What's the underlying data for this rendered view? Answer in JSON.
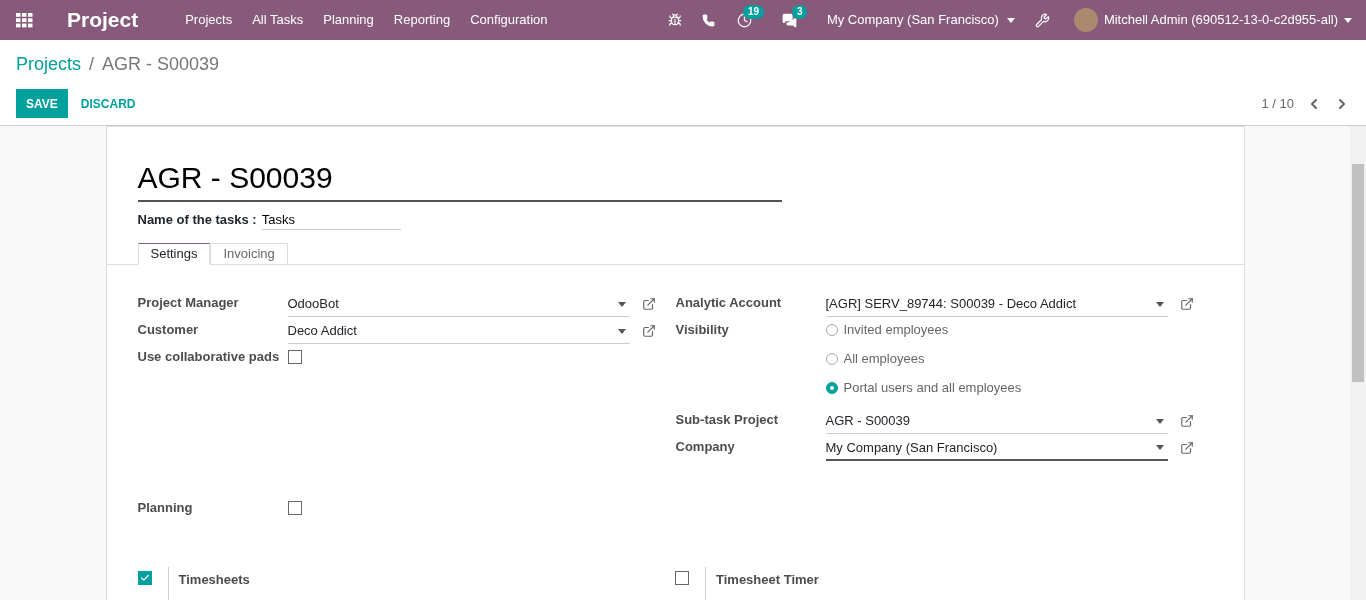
{
  "navbar": {
    "app_title": "Project",
    "menu": [
      "Projects",
      "All Tasks",
      "Planning",
      "Reporting",
      "Configuration"
    ],
    "activity_count": "19",
    "message_count": "3",
    "company": "My Company (San Francisco)",
    "user": "Mitchell Admin (690512-13-0-c2d955-all)"
  },
  "breadcrumb": {
    "items": [
      "Projects",
      "AGR - S00039"
    ],
    "separator": "/"
  },
  "buttons": {
    "save": "SAVE",
    "discard": "DISCARD"
  },
  "pager": "1 / 10",
  "form": {
    "title": "AGR - S00039",
    "tasks_label": "Name of the tasks :",
    "tasks_value": "Tasks",
    "tabs": [
      {
        "label": "Settings",
        "selected": true
      },
      {
        "label": "Invoicing",
        "selected": false
      }
    ],
    "left_fields": [
      {
        "kind": "many2one",
        "label": "Project Manager",
        "value": "OdooBot",
        "focused": false
      },
      {
        "kind": "many2one",
        "label": "Customer",
        "value": "Deco Addict",
        "focused": false
      },
      {
        "kind": "checkbox",
        "label": "Use collaborative pads",
        "checked": false
      }
    ],
    "right_fields": [
      {
        "kind": "many2one",
        "label": "Analytic Account",
        "value": "[AGR] SERV_89744: S00039 - Deco Addict",
        "focused": false
      },
      {
        "kind": "radio",
        "label": "Visibility",
        "options": [
          {
            "label": "Invited employees",
            "selected": false
          },
          {
            "label": "All employees",
            "selected": false
          },
          {
            "label": "Portal users and all employees",
            "selected": true
          }
        ]
      },
      {
        "kind": "many2one",
        "label": "Sub-task Project",
        "value": "AGR - S00039",
        "focused": false
      },
      {
        "kind": "many2one",
        "label": "Company",
        "value": "My Company (San Francisco)",
        "focused": true
      }
    ],
    "planning": {
      "label": "Planning",
      "checked": false
    },
    "settings": [
      {
        "label": "Timesheets",
        "checked": true
      },
      {
        "label": "Timesheet Timer",
        "checked": false
      }
    ]
  }
}
